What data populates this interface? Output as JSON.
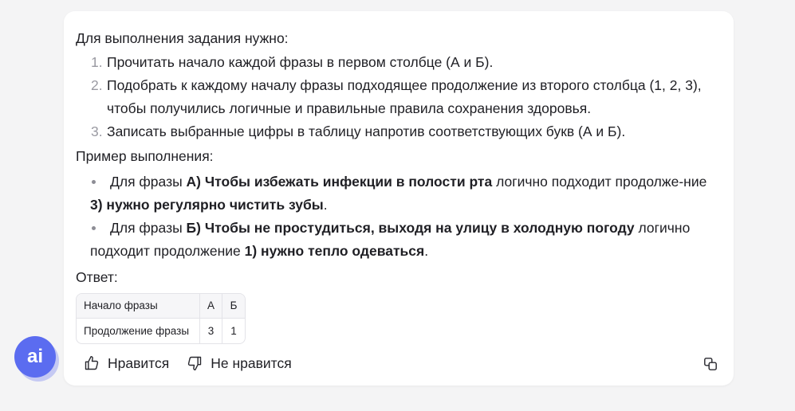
{
  "message": {
    "intro": "Для выполнения задания нужно:",
    "steps": [
      {
        "num": "1.",
        "text": "Прочитать начало каждой фразы в первом столбце (А и Б)."
      },
      {
        "num": "2.",
        "text": "Подобрать к каждому началу фразы подходящее продолжение из второго столбца (1, 2, 3), чтобы получились логичные и правильные правила сохранения здоровья."
      },
      {
        "num": "3.",
        "text": "Записать выбранные цифры в таблицу напротив соответствующих букв (А и Б)."
      }
    ],
    "example_label": "Пример выполнения:",
    "examples": [
      {
        "prefix": "Для фразы ",
        "phrase": "А) Чтобы избежать инфекции в полости рта",
        "middle": " логично подходит продолже-ние ",
        "continuation": "3) нужно регулярно чистить зубы",
        "suffix": "."
      },
      {
        "prefix": "Для фразы ",
        "phrase": "Б) Чтобы не простудиться, выходя на улицу в холодную погоду",
        "middle": " логично подходит продолжение ",
        "continuation": "1) нужно тепло одеваться",
        "suffix": "."
      }
    ],
    "answer_label": "Ответ:",
    "table": {
      "header": {
        "label": "Начало фразы",
        "a": "А",
        "b": "Б"
      },
      "row": {
        "label": "Продолжение фразы",
        "a": "3",
        "b": "1"
      }
    }
  },
  "actions": {
    "like_label": "Нравится",
    "dislike_label": "Не нравится",
    "like_icon": "thumbs-up-icon",
    "dislike_icon": "thumbs-down-icon",
    "copy_icon": "copy-icon"
  },
  "badge": {
    "label": "ai",
    "color": "#5b6cf0"
  }
}
